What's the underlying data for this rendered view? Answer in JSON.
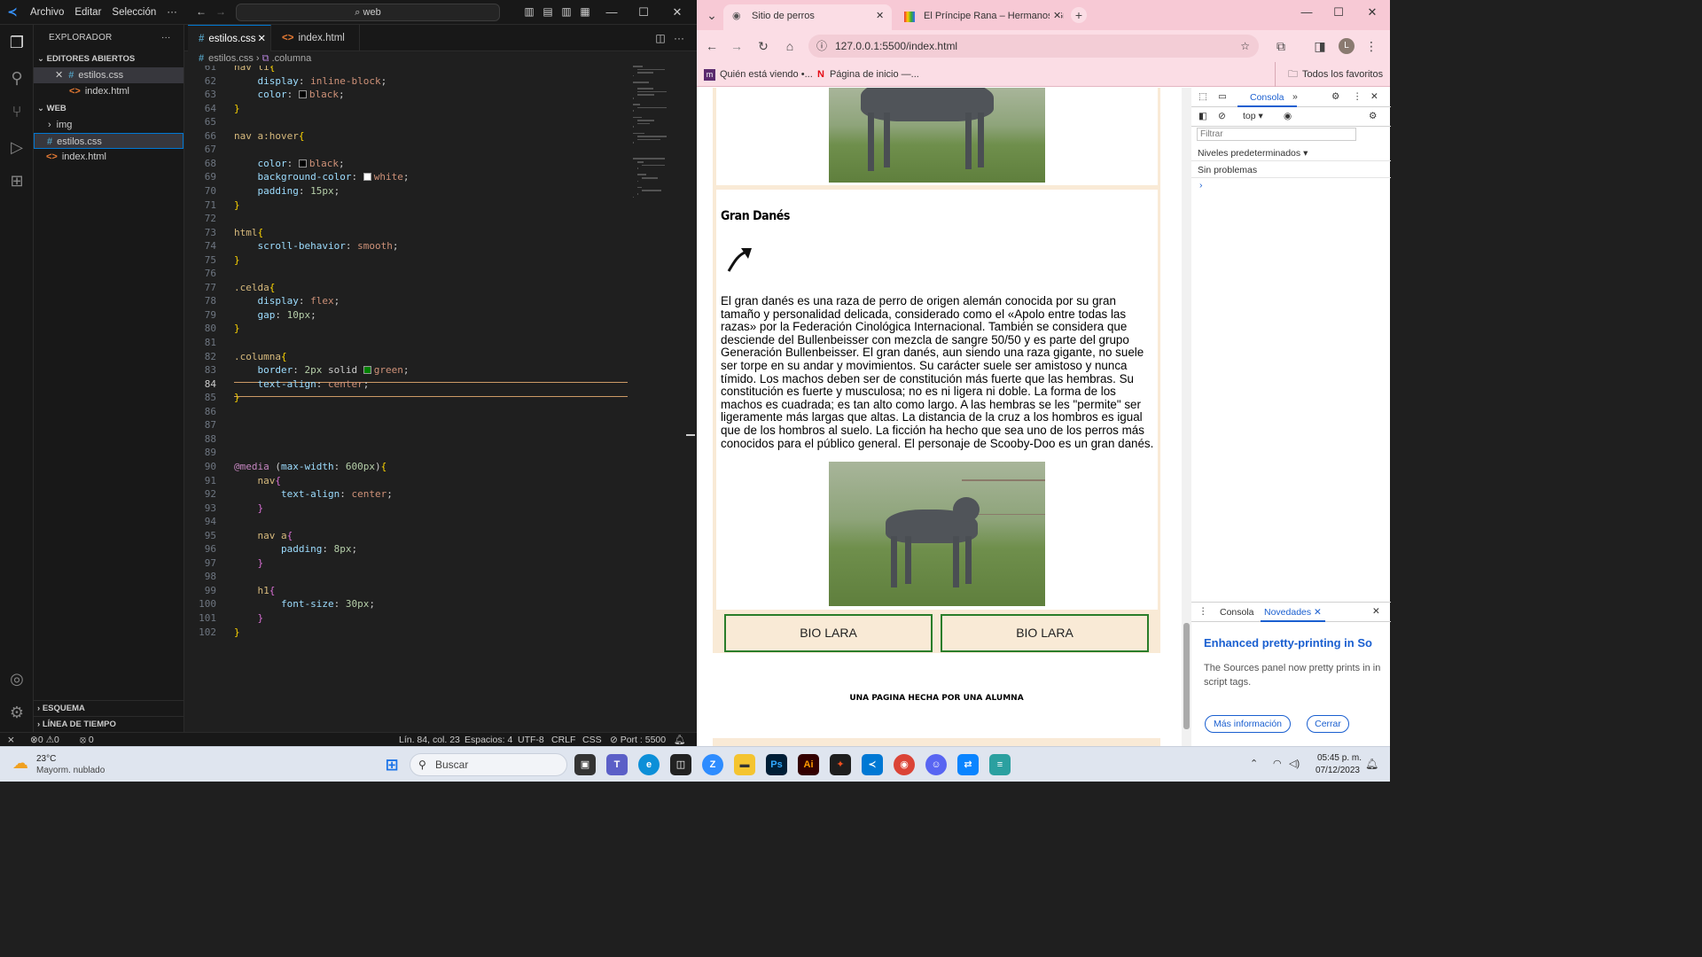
{
  "vscode": {
    "menu": [
      "Archivo",
      "Editar",
      "Selección",
      "···"
    ],
    "search": "web",
    "sidebar": {
      "title": "EXPLORADOR",
      "open_editors_label": "EDITORES ABIERTOS",
      "open_editors": [
        "estilos.css",
        "index.html"
      ],
      "folder_label": "WEB",
      "tree": [
        "img",
        "estilos.css",
        "index.html"
      ],
      "outline_label": "ESQUEMA",
      "timeline_label": "LÍNEA DE TIEMPO"
    },
    "tabs": [
      "estilos.css",
      "index.html"
    ],
    "breadcrumb": {
      "file": "estilos.css",
      "symbol": ".columna"
    },
    "status": {
      "errors": "0",
      "warnings": "0",
      "ports": "0",
      "position": "Lín. 84, col. 23",
      "spaces": "Espacios: 4",
      "encoding": "UTF-8",
      "eol": "CRLF",
      "language": "CSS",
      "port": "Port : 5500"
    }
  },
  "code": [
    {
      "n": "61",
      "t": "nav li {"
    },
    {
      "n": "62",
      "t": "    display: inline-block;"
    },
    {
      "n": "63",
      "t": "    color: black;"
    },
    {
      "n": "64",
      "t": "}"
    },
    {
      "n": "65",
      "t": ""
    },
    {
      "n": "66",
      "t": "nav a:hover {"
    },
    {
      "n": "67",
      "t": ""
    },
    {
      "n": "68",
      "t": "    color: black;"
    },
    {
      "n": "69",
      "t": "    background-color: white;"
    },
    {
      "n": "70",
      "t": "    padding: 15px;"
    },
    {
      "n": "71",
      "t": "}"
    },
    {
      "n": "72",
      "t": ""
    },
    {
      "n": "73",
      "t": "html {"
    },
    {
      "n": "74",
      "t": "    scroll-behavior: smooth;"
    },
    {
      "n": "75",
      "t": "}"
    },
    {
      "n": "76",
      "t": ""
    },
    {
      "n": "77",
      "t": ".celda{"
    },
    {
      "n": "78",
      "t": "    display: flex;"
    },
    {
      "n": "79",
      "t": "    gap: 10px;"
    },
    {
      "n": "80",
      "t": "}"
    },
    {
      "n": "81",
      "t": ""
    },
    {
      "n": "82",
      "t": ".columna{"
    },
    {
      "n": "83",
      "t": "    border: 2px solid green;"
    },
    {
      "n": "84",
      "t": "    text-align: center;"
    },
    {
      "n": "85",
      "t": "}"
    },
    {
      "n": "86",
      "t": ""
    },
    {
      "n": "87",
      "t": ""
    },
    {
      "n": "88",
      "t": ""
    },
    {
      "n": "89",
      "t": ""
    },
    {
      "n": "90",
      "t": "@media (max-width: 600px){"
    },
    {
      "n": "91",
      "t": "    nav {"
    },
    {
      "n": "92",
      "t": "        text-align: center;"
    },
    {
      "n": "93",
      "t": "    }"
    },
    {
      "n": "94",
      "t": ""
    },
    {
      "n": "95",
      "t": "    nav a {"
    },
    {
      "n": "96",
      "t": "        padding: 8px;"
    },
    {
      "n": "97",
      "t": "    }"
    },
    {
      "n": "98",
      "t": ""
    },
    {
      "n": "99",
      "t": "    h1 {"
    },
    {
      "n": "100",
      "t": "        font-size: 30px;"
    },
    {
      "n": "101",
      "t": "    }"
    },
    {
      "n": "102",
      "t": "}"
    }
  ],
  "chrome": {
    "tabs": [
      "Sitio de perros",
      "El Príncipe Rana – Hermanos Gr"
    ],
    "url": "127.0.0.1:5500/index.html",
    "bookmarks": [
      "Quién está viendo •...",
      "Página de inicio —...",
      "Todos los favoritos"
    ],
    "profile_initial": "L"
  },
  "page": {
    "dog_title": "Gran Danés",
    "dog_text": "El gran danés es una raza de perro de origen alemán conocida por su gran tamaño y personalidad delicada, considerado como el «Apolo entre todas las razas» por la Federación Cinológica Internacional. También se considera que desciende del Bullenbeisser con mezcla de sangre 50/50 y es parte del grupo Generación Bullenbeisser. El gran danés, aun siendo una raza gigante, no suele ser torpe en su andar y movimientos. Su carácter suele ser amistoso y nunca tímido. Los machos deben ser de constitución más fuerte que las hembras. Su constitución es fuerte y musculosa; no es ni ligera ni doble. La forma de los machos es cuadrada; es tan alto como largo. A las hembras se les \"permite\" ser ligeramente más largas que altas. La distancia de la cruz a los hombros es igual que de los hombros al suelo. La ficción ha hecho que sea uno de los perros más conocidos para el público general. El personaje de Scooby-Doo es un gran danés.",
    "bio_left": "BIO LARA",
    "bio_right": "BIO LARA",
    "footer": "UNA PAGINA HECHA POR UNA ALUMNA"
  },
  "devtools": {
    "tab_console": "Consola",
    "context": "top",
    "filter_placeholder": "Filtrar",
    "levels": "Niveles predeterminados",
    "no_issues": "Sin problemas",
    "drawer_tabs": [
      "Consola",
      "Novedades"
    ],
    "news_title": "Enhanced pretty-printing in So",
    "news_body": "The Sources panel now pretty prints in in script tags.",
    "more_info": "Más información",
    "close": "Cerrar"
  },
  "taskbar": {
    "temp": "23°C",
    "weather": "Mayorm. nublado",
    "search": "Buscar",
    "time": "05:45 p. m.",
    "date": "07/12/2023"
  },
  "colors": {
    "accent": "#0078d4",
    "chrome_frame": "#f7c9d5",
    "page_bg": "#f9ead6",
    "bio_border": "#2a7d2a"
  }
}
